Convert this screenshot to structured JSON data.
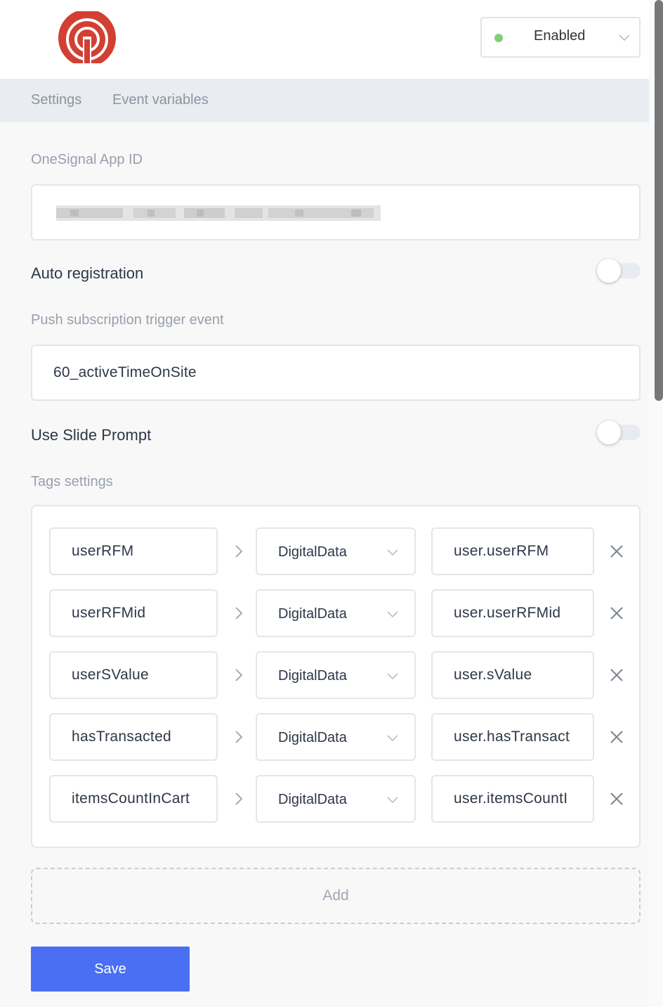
{
  "header": {
    "status": {
      "label": "Enabled",
      "dot_color": "#7ed07a"
    }
  },
  "tabs": [
    {
      "label": "Settings"
    },
    {
      "label": "Event variables"
    }
  ],
  "form": {
    "app_id": {
      "label": "OneSignal App ID"
    },
    "auto_registration": {
      "label": "Auto registration",
      "enabled": false
    },
    "trigger_event": {
      "label": "Push subscription trigger event",
      "value": "60_activeTimeOnSite"
    },
    "slide_prompt": {
      "label": "Use Slide Prompt",
      "enabled": false
    },
    "tags": {
      "label": "Tags settings",
      "rows": [
        {
          "name": "userRFM",
          "source": "DigitalData",
          "path": "user.userRFM"
        },
        {
          "name": "userRFMid",
          "source": "DigitalData",
          "path": "user.userRFMid"
        },
        {
          "name": "userSValue",
          "source": "DigitalData",
          "path": "user.sValue"
        },
        {
          "name": "hasTransacted",
          "source": "DigitalData",
          "path": "user.hasTransact"
        },
        {
          "name": "itemsCountInCart",
          "source": "DigitalData",
          "path": "user.itemsCountI"
        }
      ]
    },
    "add_label": "Add",
    "save_label": "Save"
  },
  "colors": {
    "accent": "#4a6ff2",
    "brand": "#d23f33"
  }
}
